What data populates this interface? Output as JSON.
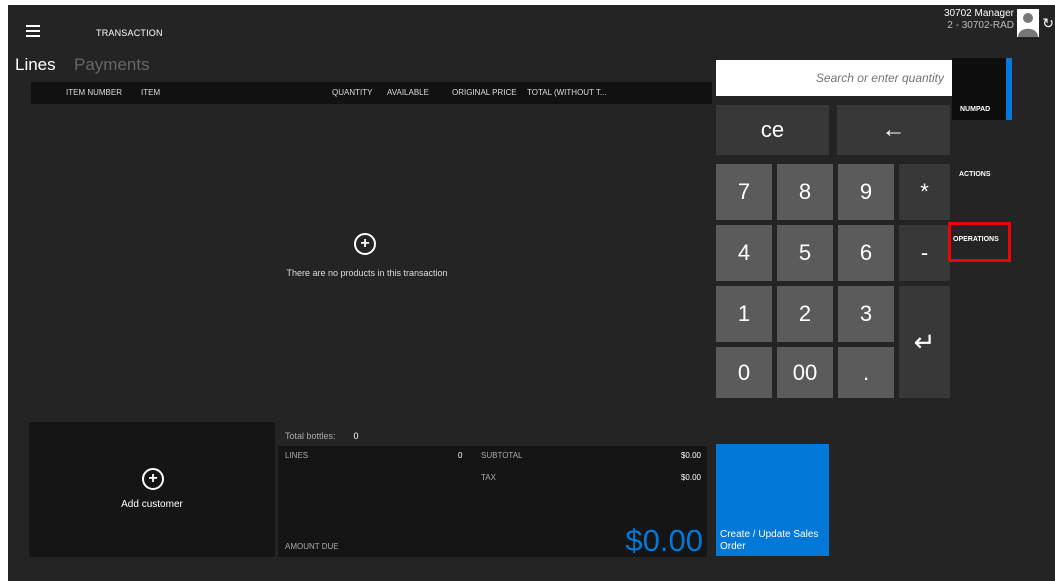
{
  "header": {
    "title": "TRANSACTION",
    "user_name": "30702 Manager",
    "user_store": "2 - 30702-RAD"
  },
  "tabs": [
    {
      "label": "Lines"
    },
    {
      "label": "Payments"
    }
  ],
  "grid": {
    "columns": [
      "ITEM NUMBER",
      "ITEM",
      "QUANTITY",
      "AVAILABLE",
      "ORIGINAL PRICE",
      "TOTAL (WITHOUT T..."
    ]
  },
  "empty_message": "There are no products in this transaction",
  "customer": {
    "label": "Add customer"
  },
  "totals": {
    "bottles_label": "Total bottles:",
    "bottles_value": "0",
    "lines_label": "LINES",
    "lines_value": "0",
    "subtotal_label": "SUBTOTAL",
    "subtotal_value": "$0.00",
    "tax_label": "TAX",
    "tax_value": "$0.00",
    "amount_due_label": "AMOUNT DUE",
    "amount_due_value": "$0.00"
  },
  "search": {
    "placeholder": "Search or enter quantity"
  },
  "numpad": {
    "ce": "ce",
    "backspace": "←",
    "enter": "↵",
    "digits": [
      "7",
      "8",
      "9",
      "*",
      "4",
      "5",
      "6",
      "-",
      "1",
      "2",
      "3",
      "0",
      "00",
      "."
    ]
  },
  "side_tabs": {
    "numpad": "NUMPAD",
    "actions": "ACTIONS",
    "operations": "OPERATIONS"
  },
  "create_order": {
    "label": "Create / Update Sales Order"
  },
  "colors": {
    "accent": "#0078d7",
    "highlight": "#e00000",
    "background": "#242424"
  }
}
